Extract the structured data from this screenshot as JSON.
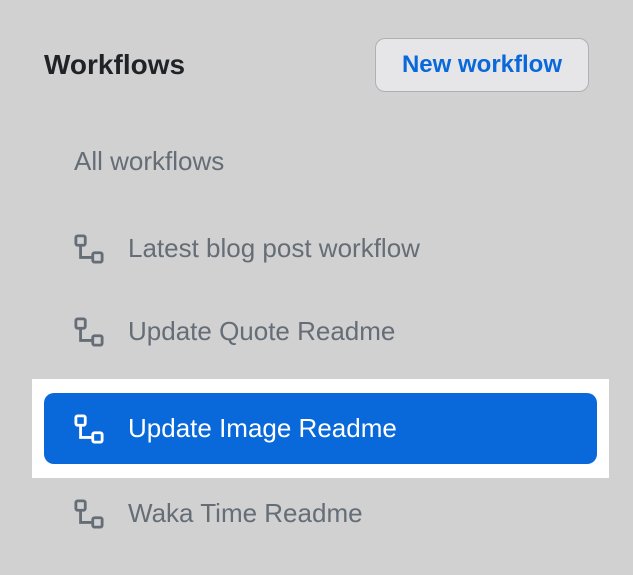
{
  "header": {
    "title": "Workflows",
    "new_button": "New workflow"
  },
  "workflows": {
    "all_label": "All workflows",
    "items": [
      {
        "label": "Latest blog post workflow"
      },
      {
        "label": "Update Quote Readme"
      },
      {
        "label": "Update Image Readme"
      },
      {
        "label": "Waka Time Readme"
      }
    ]
  }
}
